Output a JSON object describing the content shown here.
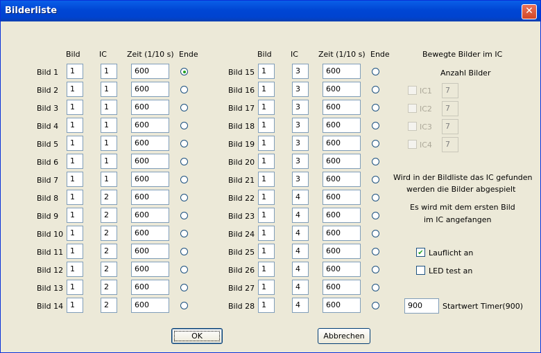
{
  "window": {
    "title": "Bilderliste"
  },
  "headers": {
    "bild": "Bild",
    "ic": "IC",
    "zeit": "Zeit (1/10 s)",
    "ende": "Ende"
  },
  "rows_left": [
    {
      "label": "Bild 1",
      "bild": "1",
      "ic": "1",
      "zeit": "600",
      "ende": true
    },
    {
      "label": "Bild 2",
      "bild": "1",
      "ic": "1",
      "zeit": "600",
      "ende": false
    },
    {
      "label": "Bild 3",
      "bild": "1",
      "ic": "1",
      "zeit": "600",
      "ende": false
    },
    {
      "label": "Bild 4",
      "bild": "1",
      "ic": "1",
      "zeit": "600",
      "ende": false
    },
    {
      "label": "Bild 5",
      "bild": "1",
      "ic": "1",
      "zeit": "600",
      "ende": false
    },
    {
      "label": "Bild 6",
      "bild": "1",
      "ic": "1",
      "zeit": "600",
      "ende": false
    },
    {
      "label": "Bild 7",
      "bild": "1",
      "ic": "1",
      "zeit": "600",
      "ende": false
    },
    {
      "label": "Bild 8",
      "bild": "1",
      "ic": "2",
      "zeit": "600",
      "ende": false
    },
    {
      "label": "Bild 9",
      "bild": "1",
      "ic": "2",
      "zeit": "600",
      "ende": false
    },
    {
      "label": "Bild 10",
      "bild": "1",
      "ic": "2",
      "zeit": "600",
      "ende": false
    },
    {
      "label": "Bild 11",
      "bild": "1",
      "ic": "2",
      "zeit": "600",
      "ende": false
    },
    {
      "label": "Bild 12",
      "bild": "1",
      "ic": "2",
      "zeit": "600",
      "ende": false
    },
    {
      "label": "Bild 13",
      "bild": "1",
      "ic": "2",
      "zeit": "600",
      "ende": false
    },
    {
      "label": "Bild 14",
      "bild": "1",
      "ic": "2",
      "zeit": "600",
      "ende": false
    }
  ],
  "rows_right": [
    {
      "label": "Bild 15",
      "bild": "1",
      "ic": "3",
      "zeit": "600",
      "ende": false
    },
    {
      "label": "Bild 16",
      "bild": "1",
      "ic": "3",
      "zeit": "600",
      "ende": false
    },
    {
      "label": "Bild 17",
      "bild": "1",
      "ic": "3",
      "zeit": "600",
      "ende": false
    },
    {
      "label": "Bild 18",
      "bild": "1",
      "ic": "3",
      "zeit": "600",
      "ende": false
    },
    {
      "label": "Bild 19",
      "bild": "1",
      "ic": "3",
      "zeit": "600",
      "ende": false
    },
    {
      "label": "Bild 20",
      "bild": "1",
      "ic": "3",
      "zeit": "600",
      "ende": false
    },
    {
      "label": "Bild 21",
      "bild": "1",
      "ic": "3",
      "zeit": "600",
      "ende": false
    },
    {
      "label": "Bild 22",
      "bild": "1",
      "ic": "4",
      "zeit": "600",
      "ende": false
    },
    {
      "label": "Bild 23",
      "bild": "1",
      "ic": "4",
      "zeit": "600",
      "ende": false
    },
    {
      "label": "Bild 24",
      "bild": "1",
      "ic": "4",
      "zeit": "600",
      "ende": false
    },
    {
      "label": "Bild 25",
      "bild": "1",
      "ic": "4",
      "zeit": "600",
      "ende": false
    },
    {
      "label": "Bild 26",
      "bild": "1",
      "ic": "4",
      "zeit": "600",
      "ende": false
    },
    {
      "label": "Bild 27",
      "bild": "1",
      "ic": "4",
      "zeit": "600",
      "ende": false
    },
    {
      "label": "Bild 28",
      "bild": "1",
      "ic": "4",
      "zeit": "600",
      "ende": false
    }
  ],
  "panel": {
    "title": "Bewegte Bilder im IC",
    "subtitle": "Anzahl Bilder",
    "ic_items": [
      {
        "label": "IC1",
        "value": "7",
        "checked": false
      },
      {
        "label": "IC2",
        "value": "7",
        "checked": false
      },
      {
        "label": "IC3",
        "value": "7",
        "checked": false
      },
      {
        "label": "IC4",
        "value": "7",
        "checked": false
      }
    ],
    "info1_line1": "Wird in der Bildliste das IC gefunden",
    "info1_line2": "werden die Bilder abgespielt",
    "info2_line1": "Es wird mit dem ersten Bild",
    "info2_line2": "im IC angefangen",
    "lauflicht_label": "Lauflicht an",
    "lauflicht_checked": true,
    "ledtest_label": "LED test an",
    "ledtest_checked": false,
    "timer_value": "900",
    "timer_label": "Startwert Timer(900)"
  },
  "buttons": {
    "ok": "OK",
    "cancel": "Abbrechen"
  }
}
